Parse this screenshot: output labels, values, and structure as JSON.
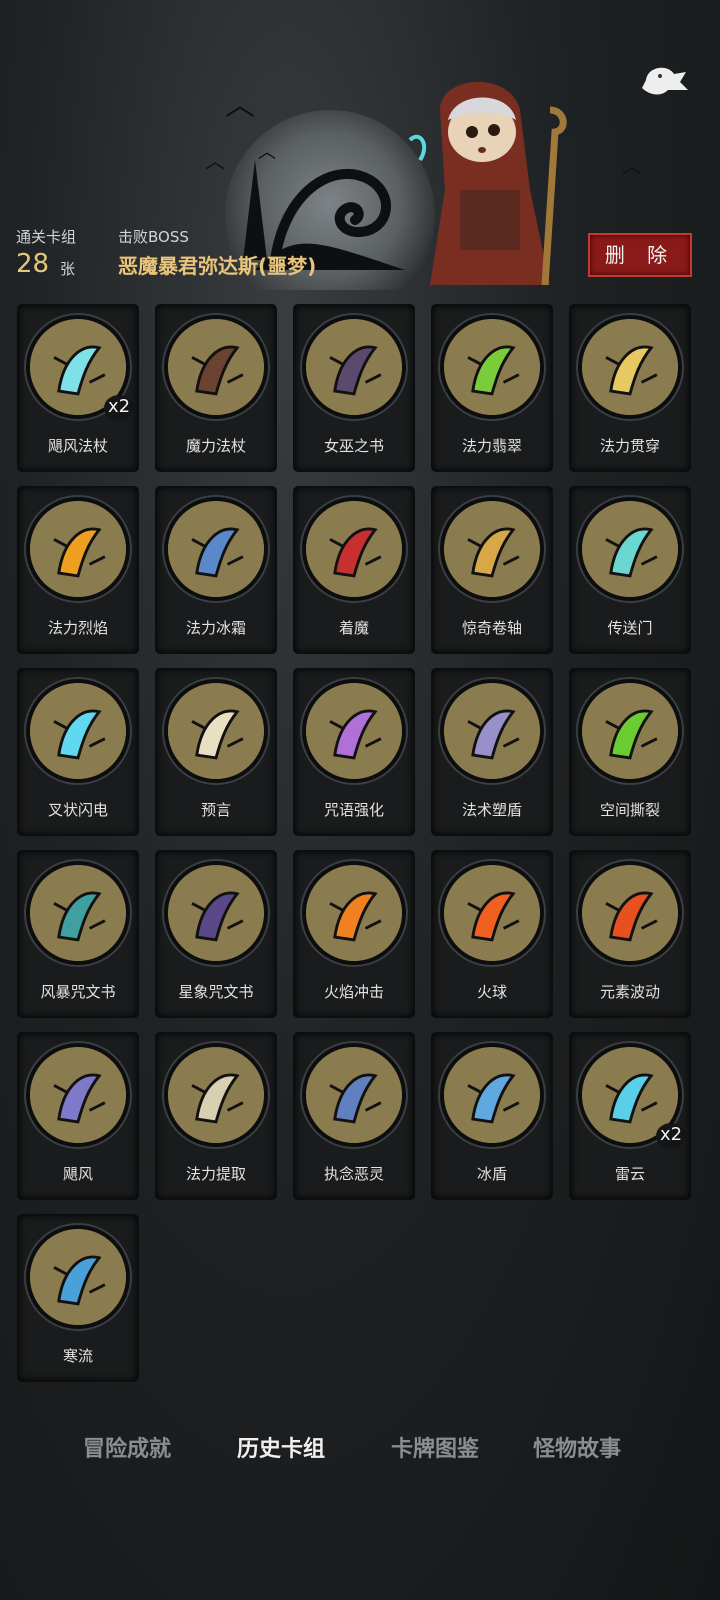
{
  "header": {
    "deck_label": "通关卡组",
    "card_count": "28",
    "card_unit": "张",
    "boss_label": "击败BOSS",
    "boss_name": "恶魔暴君弥达斯(噩梦)",
    "delete_label": "删 除"
  },
  "cards": [
    {
      "name": "飓风法杖",
      "badge": "x2",
      "icon": "staff-icon",
      "color": "#7fe0e8"
    },
    {
      "name": "魔力法杖",
      "badge": "",
      "icon": "crook-staff-icon",
      "color": "#6b4330"
    },
    {
      "name": "女巫之书",
      "badge": "",
      "icon": "skull-book-icon",
      "color": "#5b4a6e"
    },
    {
      "name": "法力翡翠",
      "badge": "",
      "icon": "emerald-icon",
      "color": "#7acc3a"
    },
    {
      "name": "法力贯穿",
      "badge": "",
      "icon": "pierce-icon",
      "color": "#e8c860"
    },
    {
      "name": "法力烈焰",
      "badge": "",
      "icon": "flame-icon",
      "color": "#f0a020"
    },
    {
      "name": "法力冰霜",
      "badge": "",
      "icon": "frost-icon",
      "color": "#5a88c8"
    },
    {
      "name": "着魔",
      "badge": "",
      "icon": "possessed-icon",
      "color": "#c83030"
    },
    {
      "name": "惊奇卷轴",
      "badge": "",
      "icon": "scroll-icon",
      "color": "#d8a848"
    },
    {
      "name": "传送门",
      "badge": "",
      "icon": "portal-icon",
      "color": "#6ad8d0"
    },
    {
      "name": "叉状闪电",
      "badge": "",
      "icon": "lightning-icon",
      "color": "#60d8f0"
    },
    {
      "name": "预言",
      "badge": "",
      "icon": "prophet-icon",
      "color": "#e8e0c0"
    },
    {
      "name": "咒语强化",
      "badge": "",
      "icon": "crystal-icon",
      "color": "#b070d8"
    },
    {
      "name": "法术塑盾",
      "badge": "",
      "icon": "shield-icon",
      "color": "#9890c8"
    },
    {
      "name": "空间撕裂",
      "badge": "",
      "icon": "rift-icon",
      "color": "#6acc30"
    },
    {
      "name": "风暴咒文书",
      "badge": "",
      "icon": "storm-book-icon",
      "color": "#40a0a0"
    },
    {
      "name": "星象咒文书",
      "badge": "",
      "icon": "star-book-icon",
      "color": "#5a4888"
    },
    {
      "name": "火焰冲击",
      "badge": "",
      "icon": "fireball-small-icon",
      "color": "#f08020"
    },
    {
      "name": "火球",
      "badge": "",
      "icon": "fireball-icon",
      "color": "#f06020"
    },
    {
      "name": "元素波动",
      "badge": "",
      "icon": "elements-icon",
      "color": "#e85020"
    },
    {
      "name": "飓风",
      "badge": "",
      "icon": "tornado-icon",
      "color": "#8078c8"
    },
    {
      "name": "法力提取",
      "badge": "",
      "icon": "skull-icon",
      "color": "#d8d0b0"
    },
    {
      "name": "执念恶灵",
      "badge": "",
      "icon": "wraith-icon",
      "color": "#6080c0"
    },
    {
      "name": "冰盾",
      "badge": "",
      "icon": "ice-wizard-icon",
      "color": "#60a8e0"
    },
    {
      "name": "雷云",
      "badge": "x2",
      "icon": "storm-cloud-icon",
      "color": "#5ad0e8"
    },
    {
      "name": "寒流",
      "badge": "",
      "icon": "cold-wave-icon",
      "color": "#4aa0d8"
    }
  ],
  "tabs": [
    {
      "label": "冒险成就",
      "active": false
    },
    {
      "label": "历史卡组",
      "active": true
    },
    {
      "label": "卡牌图鉴",
      "active": false
    },
    {
      "label": "怪物故事",
      "active": false
    }
  ]
}
